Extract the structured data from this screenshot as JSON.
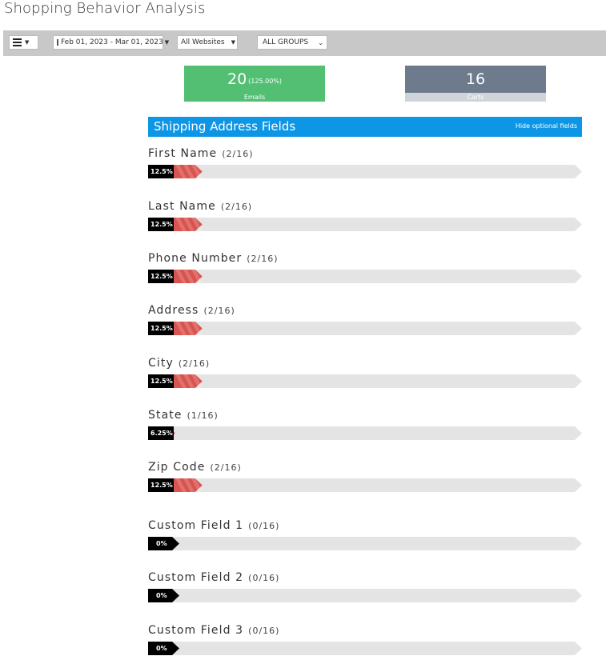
{
  "page": {
    "title": "Shopping Behavior Analysis"
  },
  "toolbar": {
    "date_range": "Feb 01, 2023 - Mar 01, 2023",
    "websites": "All Websites",
    "groups": "ALL GROUPS"
  },
  "stats": {
    "emails": {
      "value": "20",
      "sub": "(125.00%)",
      "label": "Emails"
    },
    "carts": {
      "value": "16",
      "label": "Carts"
    }
  },
  "section": {
    "title": "Shipping Address Fields",
    "hide_label": "Hide optional fields"
  },
  "colors": {
    "accent": "#0e96e6",
    "emails": "#52bf72",
    "carts": "#6d7b8c",
    "bar": "#d9534f",
    "track": "#e4e4e4"
  },
  "fields": [
    {
      "label": "First Name",
      "count": "(2/16)",
      "percent": 12.5,
      "percent_label": "12.5%"
    },
    {
      "label": "Last Name",
      "count": "(2/16)",
      "percent": 12.5,
      "percent_label": "12.5%"
    },
    {
      "label": "Phone Number",
      "count": "(2/16)",
      "percent": 12.5,
      "percent_label": "12.5%"
    },
    {
      "label": "Address",
      "count": "(2/16)",
      "percent": 12.5,
      "percent_label": "12.5%"
    },
    {
      "label": "City",
      "count": "(2/16)",
      "percent": 12.5,
      "percent_label": "12.5%"
    },
    {
      "label": "State",
      "count": "(1/16)",
      "percent": 6.25,
      "percent_label": "6.25%"
    },
    {
      "label": "Zip Code",
      "count": "(2/16)",
      "percent": 12.5,
      "percent_label": "12.5%"
    },
    {
      "label": "Custom Field 1",
      "count": "(0/16)",
      "percent": 0,
      "percent_label": "0%"
    },
    {
      "label": "Custom Field 2",
      "count": "(0/16)",
      "percent": 0,
      "percent_label": "0%"
    },
    {
      "label": "Custom Field 3",
      "count": "(0/16)",
      "percent": 0,
      "percent_label": "0%"
    }
  ]
}
